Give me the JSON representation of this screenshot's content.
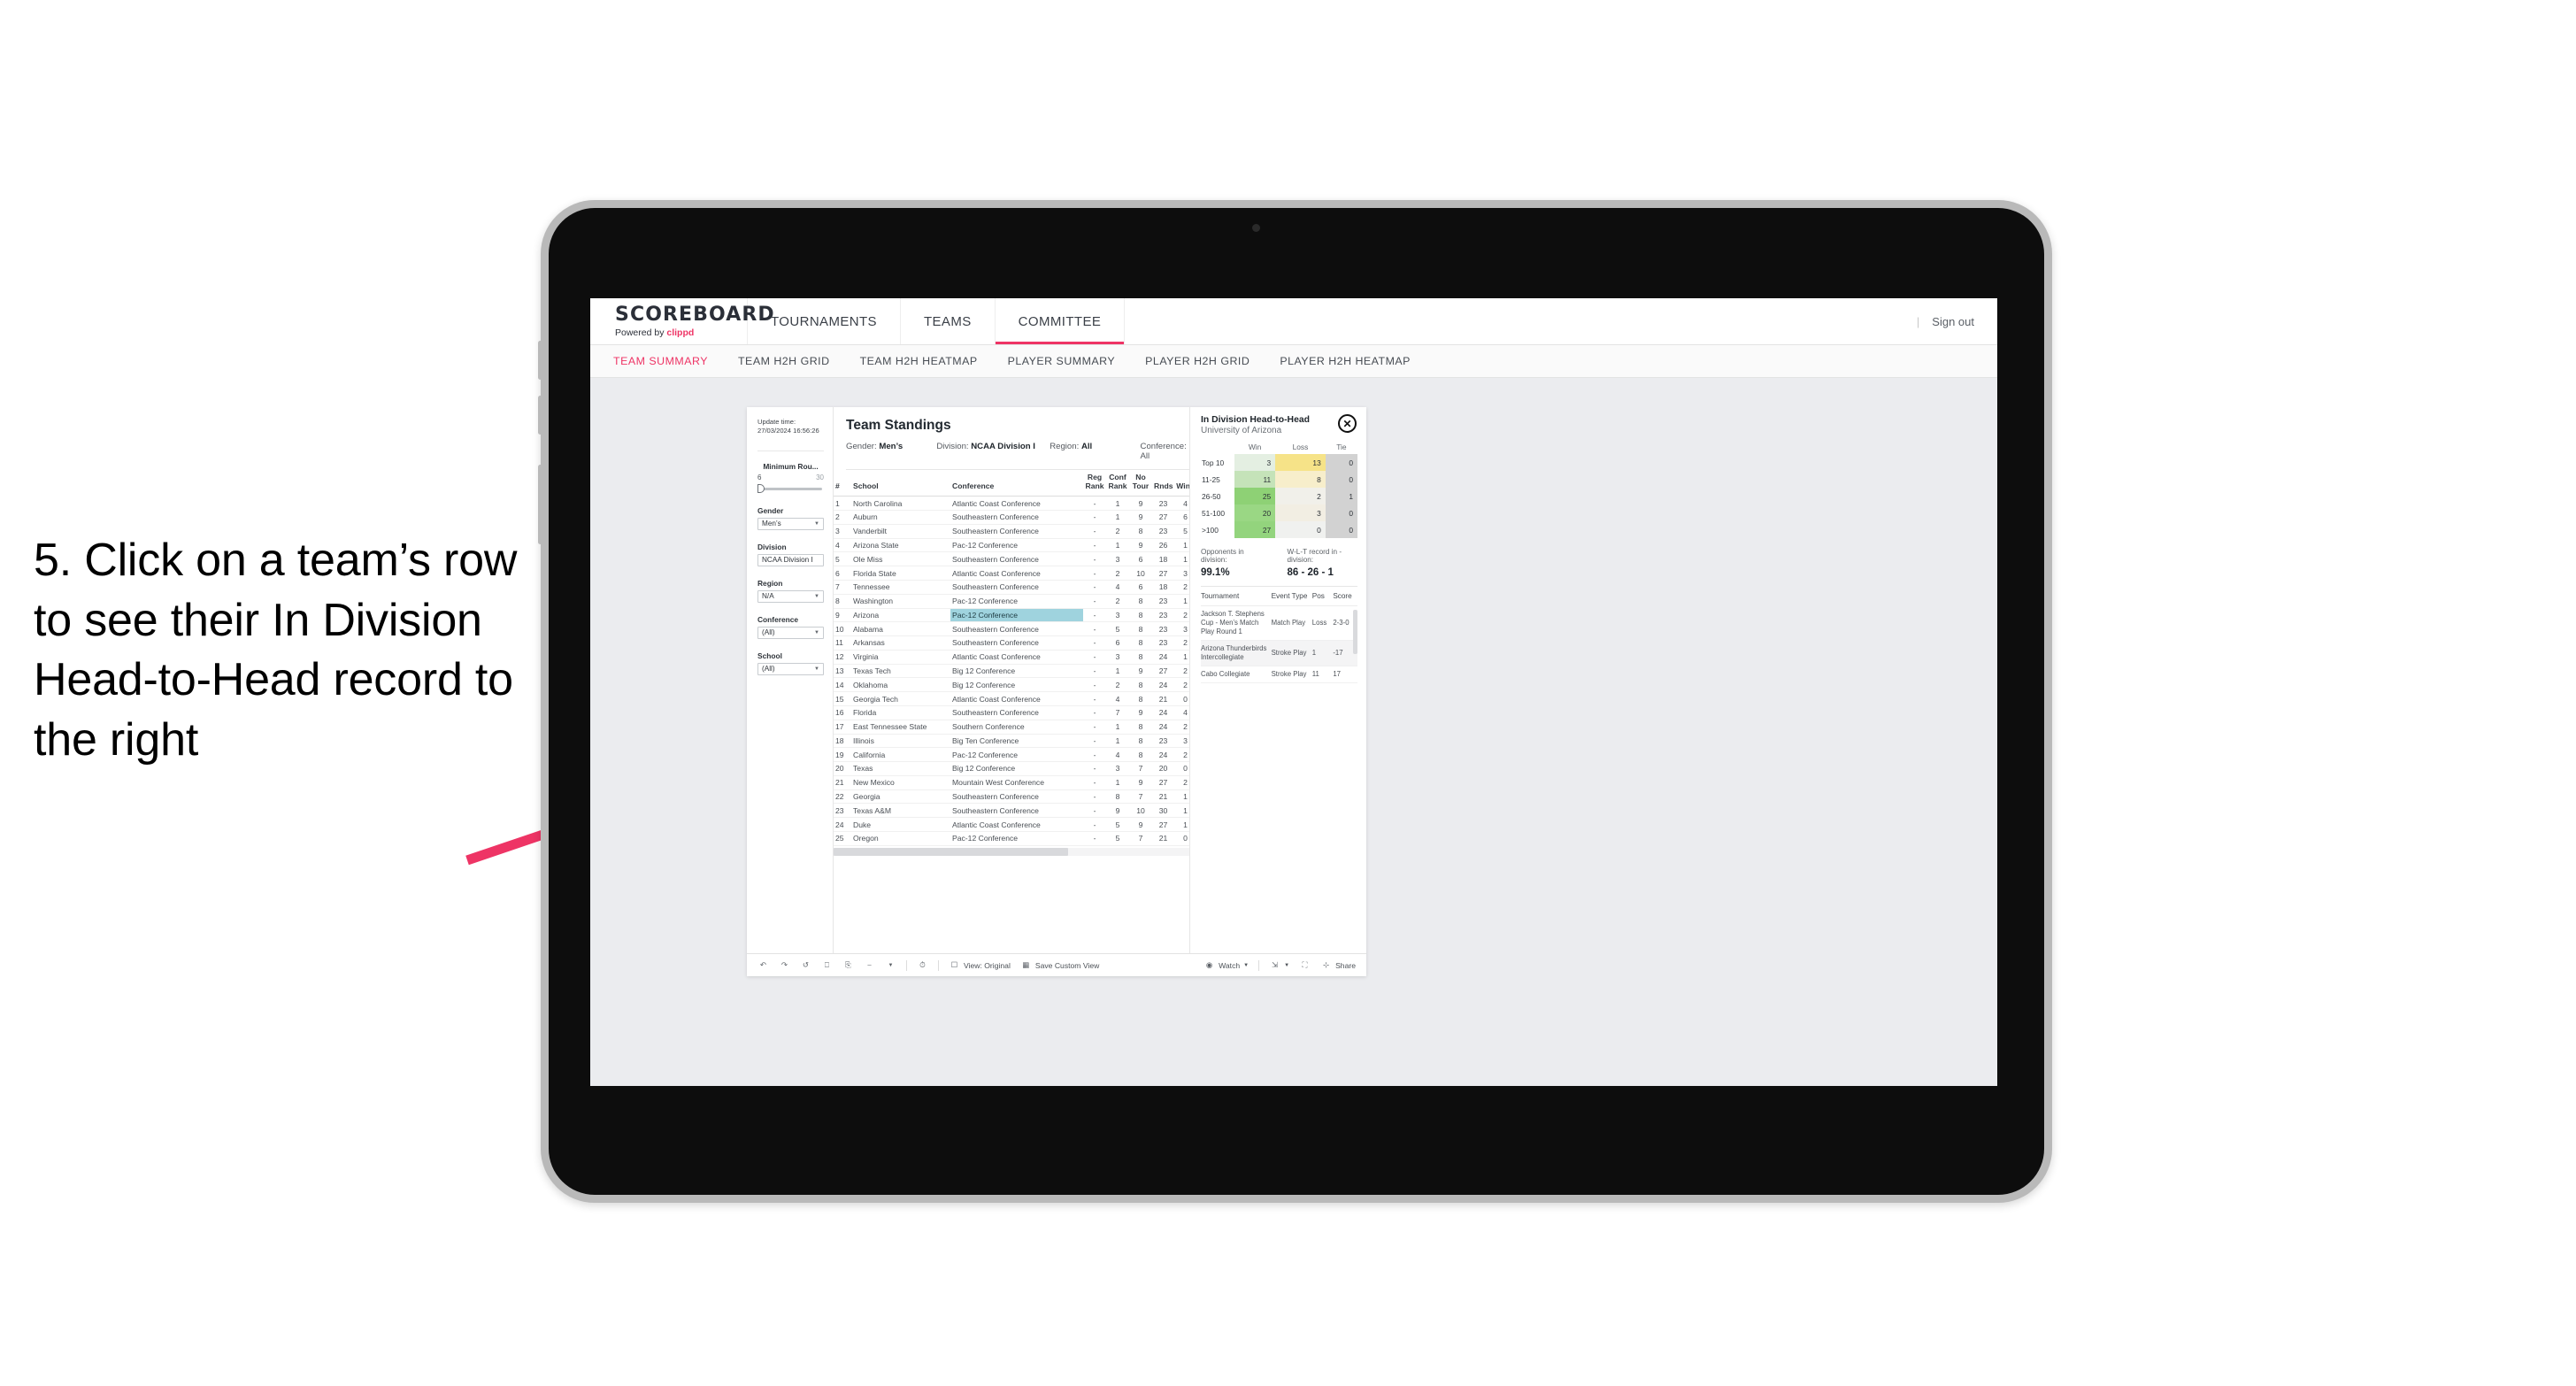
{
  "annotation": {
    "text": "5. Click on a team’s row to see their In Division Head-to-Head record to the right",
    "arrow_color": "#ee3465"
  },
  "header": {
    "brand_name": "SCOREBOARD",
    "brand_sub_prefix": "Powered by ",
    "brand_sub_accent": "clippd",
    "nav": [
      {
        "label": "TOURNAMENTS",
        "active": false
      },
      {
        "label": "TEAMS",
        "active": false
      },
      {
        "label": "COMMITTEE",
        "active": true
      }
    ],
    "sign_out": "Sign out",
    "separator": "|"
  },
  "subnav": {
    "items": [
      {
        "label": "TEAM SUMMARY",
        "active": true
      },
      {
        "label": "TEAM H2H GRID",
        "active": false
      },
      {
        "label": "TEAM H2H HEATMAP",
        "active": false
      },
      {
        "label": "PLAYER SUMMARY",
        "active": false
      },
      {
        "label": "PLAYER H2H GRID",
        "active": false
      },
      {
        "label": "PLAYER H2H HEATMAP",
        "active": false
      }
    ]
  },
  "rail": {
    "update_label": "Update time:",
    "update_value": "27/03/2024 16:56:26",
    "min_rounds_label": "Minimum Rou...",
    "min_rounds_min": "6",
    "min_rounds_max": "30",
    "filters": [
      {
        "label": "Gender",
        "value": "Men’s"
      },
      {
        "label": "Division",
        "value": "NCAA Division I"
      },
      {
        "label": "Region",
        "value": "N/A"
      },
      {
        "label": "Conference",
        "value": "(All)"
      },
      {
        "label": "School",
        "value": "(All)"
      }
    ]
  },
  "standings": {
    "title": "Team Standings",
    "filters": [
      {
        "label": "Gender:",
        "value": "Men’s"
      },
      {
        "label": "Division:",
        "value": "NCAA Division I"
      },
      {
        "label": "Region:",
        "value": "All"
      },
      {
        "label": "Conference:",
        "value": "All"
      }
    ],
    "columns": [
      "#",
      "School",
      "Conference",
      "Reg Rank",
      "Conf Rank",
      "No Tour",
      "Rnds",
      "Wins"
    ],
    "selected_row_index": 8,
    "rows": [
      [
        "1",
        "North Carolina",
        "Atlantic Coast Conference",
        "-",
        "1",
        "9",
        "23",
        "4"
      ],
      [
        "2",
        "Auburn",
        "Southeastern Conference",
        "-",
        "1",
        "9",
        "27",
        "6"
      ],
      [
        "3",
        "Vanderbilt",
        "Southeastern Conference",
        "-",
        "2",
        "8",
        "23",
        "5"
      ],
      [
        "4",
        "Arizona State",
        "Pac-12 Conference",
        "-",
        "1",
        "9",
        "26",
        "1"
      ],
      [
        "5",
        "Ole Miss",
        "Southeastern Conference",
        "-",
        "3",
        "6",
        "18",
        "1"
      ],
      [
        "6",
        "Florida State",
        "Atlantic Coast Conference",
        "-",
        "2",
        "10",
        "27",
        "3"
      ],
      [
        "7",
        "Tennessee",
        "Southeastern Conference",
        "-",
        "4",
        "6",
        "18",
        "2"
      ],
      [
        "8",
        "Washington",
        "Pac-12 Conference",
        "-",
        "2",
        "8",
        "23",
        "1"
      ],
      [
        "9",
        "Arizona",
        "Pac-12 Conference",
        "-",
        "3",
        "8",
        "23",
        "2"
      ],
      [
        "10",
        "Alabama",
        "Southeastern Conference",
        "-",
        "5",
        "8",
        "23",
        "3"
      ],
      [
        "11",
        "Arkansas",
        "Southeastern Conference",
        "-",
        "6",
        "8",
        "23",
        "2"
      ],
      [
        "12",
        "Virginia",
        "Atlantic Coast Conference",
        "-",
        "3",
        "8",
        "24",
        "1"
      ],
      [
        "13",
        "Texas Tech",
        "Big 12 Conference",
        "-",
        "1",
        "9",
        "27",
        "2"
      ],
      [
        "14",
        "Oklahoma",
        "Big 12 Conference",
        "-",
        "2",
        "8",
        "24",
        "2"
      ],
      [
        "15",
        "Georgia Tech",
        "Atlantic Coast Conference",
        "-",
        "4",
        "8",
        "21",
        "0"
      ],
      [
        "16",
        "Florida",
        "Southeastern Conference",
        "-",
        "7",
        "9",
        "24",
        "4"
      ],
      [
        "17",
        "East Tennessee State",
        "Southern Conference",
        "-",
        "1",
        "8",
        "24",
        "2"
      ],
      [
        "18",
        "Illinois",
        "Big Ten Conference",
        "-",
        "1",
        "8",
        "23",
        "3"
      ],
      [
        "19",
        "California",
        "Pac-12 Conference",
        "-",
        "4",
        "8",
        "24",
        "2"
      ],
      [
        "20",
        "Texas",
        "Big 12 Conference",
        "-",
        "3",
        "7",
        "20",
        "0"
      ],
      [
        "21",
        "New Mexico",
        "Mountain West Conference",
        "-",
        "1",
        "9",
        "27",
        "2"
      ],
      [
        "22",
        "Georgia",
        "Southeastern Conference",
        "-",
        "8",
        "7",
        "21",
        "1"
      ],
      [
        "23",
        "Texas A&M",
        "Southeastern Conference",
        "-",
        "9",
        "10",
        "30",
        "1"
      ],
      [
        "24",
        "Duke",
        "Atlantic Coast Conference",
        "-",
        "5",
        "9",
        "27",
        "1"
      ],
      [
        "25",
        "Oregon",
        "Pac-12 Conference",
        "-",
        "5",
        "7",
        "21",
        "0"
      ]
    ]
  },
  "h2h": {
    "title": "In Division Head-to-Head",
    "subtitle": "University of Arizona",
    "close_icon": "✕",
    "columns": [
      "",
      "Win",
      "Loss",
      "Tie"
    ],
    "rows": [
      {
        "bucket": "Top 10",
        "win": "3",
        "loss": "13",
        "tie": "0",
        "win_color": "#e4efe2",
        "loss_color": "#f6e388",
        "tie_color": "#d2d2d2"
      },
      {
        "bucket": "11-25",
        "win": "11",
        "loss": "8",
        "tie": "0",
        "win_color": "#c5e3b9",
        "loss_color": "#f7eecb",
        "tie_color": "#d2d2d2"
      },
      {
        "bucket": "26-50",
        "win": "25",
        "loss": "2",
        "tie": "1",
        "win_color": "#8ed175",
        "loss_color": "#f1f0ea",
        "tie_color": "#d2d2d2"
      },
      {
        "bucket": "51-100",
        "win": "20",
        "loss": "3",
        "tie": "0",
        "win_color": "#9ad784",
        "loss_color": "#f2eee3",
        "tie_color": "#d2d2d2"
      },
      {
        "bucket": ">100",
        "win": "27",
        "loss": "0",
        "tie": "0",
        "win_color": "#93d47d",
        "loss_color": "#f0f1ef",
        "tie_color": "#d2d2d2"
      }
    ],
    "stats": [
      {
        "label": "Opponents in division:",
        "value": "99.1%"
      },
      {
        "label": "W-L-T record in -division:",
        "value": "86 - 26 - 1"
      }
    ],
    "tournament_columns": [
      "Tournament",
      "Event Type",
      "Pos",
      "Score"
    ],
    "tournaments": [
      {
        "name": "Jackson T. Stephens Cup - Men’s Match Play Round 1",
        "type": "Match Play",
        "pos": "Loss",
        "score": "2-3-0"
      },
      {
        "name": "Arizona Thunderbirds Intercollegiate",
        "type": "Stroke Play",
        "pos": "1",
        "score": "-17"
      },
      {
        "name": "Cabo Collegiate",
        "type": "Stroke Play",
        "pos": "11",
        "score": "17"
      }
    ]
  },
  "toolbar": {
    "icons": [
      "undo-icon",
      "redo-icon",
      "revert-icon",
      "refresh-data-icon",
      "pause-updates-icon",
      "shape-icon",
      "dropdown-caret-icon",
      "show-hide-icon"
    ],
    "view_label": "View: Original",
    "save_label": "Save Custom View",
    "watch_label": "Watch",
    "share_label": "Share"
  }
}
